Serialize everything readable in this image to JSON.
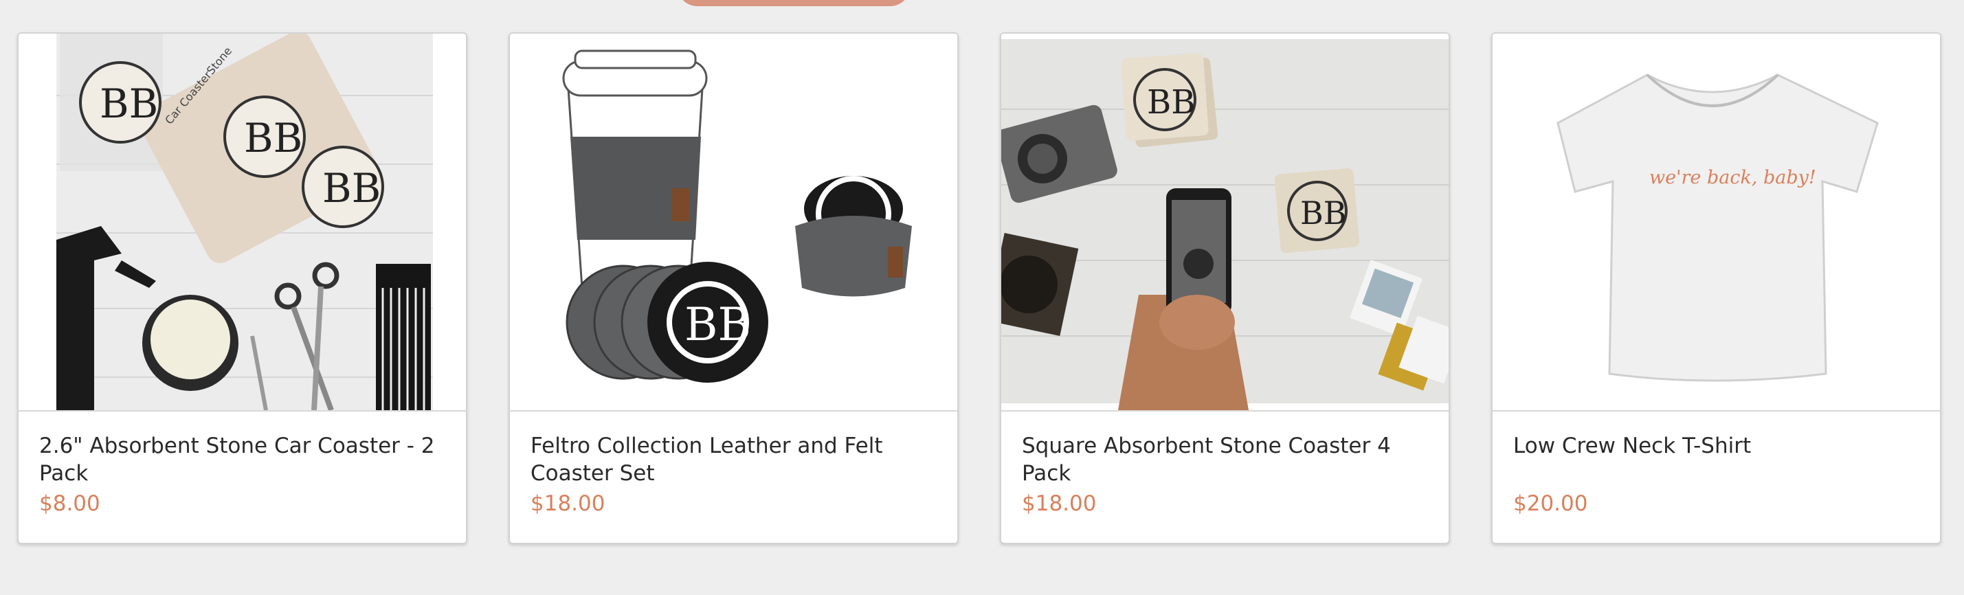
{
  "products": [
    {
      "title": "2.6\" Absorbent Stone Car Coaster - 2 Pack",
      "price": "$8.00",
      "image_label": "Car CoasterStone"
    },
    {
      "title": "Feltro Collection Leather and Felt Coaster Set",
      "price": "$18.00"
    },
    {
      "title": "Square Absorbent Stone Coaster 4 Pack",
      "price": "$18.00"
    },
    {
      "title": "Low Crew Neck T-Shirt",
      "price": "$20.00",
      "image_label": "we're back, baby!"
    }
  ],
  "brand_mark": "BB",
  "colors": {
    "accent": "#d9805b",
    "tab": "#d99680",
    "background": "#eeeeee"
  }
}
